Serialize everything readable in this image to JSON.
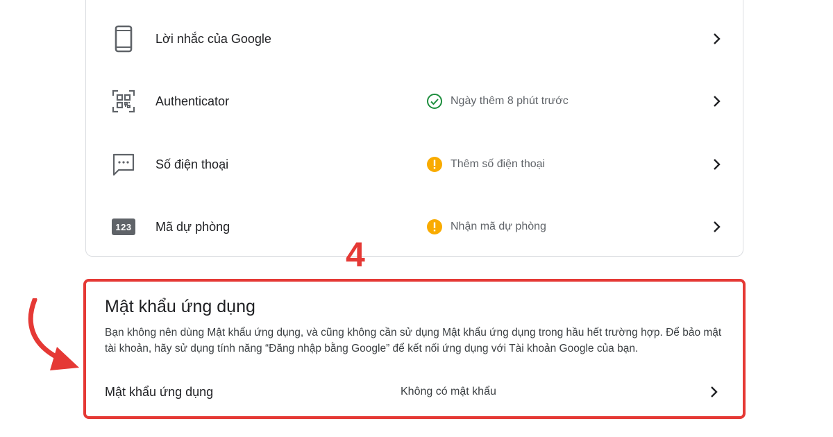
{
  "two_step_methods": {
    "items": [
      {
        "label": "Lời nhắc của Google",
        "icon": "phone-icon",
        "status": "",
        "status_icon": ""
      },
      {
        "label": "Authenticator",
        "icon": "qr-code-icon",
        "status": "Ngày thêm 8 phút trước",
        "status_icon": "check-circle-icon"
      },
      {
        "label": "Số điện thoại",
        "icon": "message-icon",
        "status": "Thêm số điện thoại",
        "status_icon": "warning-icon"
      },
      {
        "label": "Mã dự phòng",
        "icon": "backup-codes-icon",
        "icon_text": "123",
        "status": "Nhận mã dự phòng",
        "status_icon": "warning-icon"
      }
    ]
  },
  "annotation": {
    "step_number": "4"
  },
  "app_passwords": {
    "title": "Mật khẩu ứng dụng",
    "description": "Bạn không nên dùng Mật khẩu ứng dụng, và cũng không cần sử dụng Mật khẩu ứng dụng trong hầu hết trường hợp. Để bảo mật tài khoản, hãy sử dụng tính năng “Đăng nhập bằng Google” để kết nối ứng dụng với Tài khoản Google của bạn.",
    "row_label": "Mật khẩu ứng dụng",
    "row_value": "Không có mật khẩu"
  },
  "colors": {
    "success": "#1e8e3e",
    "warning": "#f9ab00",
    "annotation_red": "#e53935"
  }
}
